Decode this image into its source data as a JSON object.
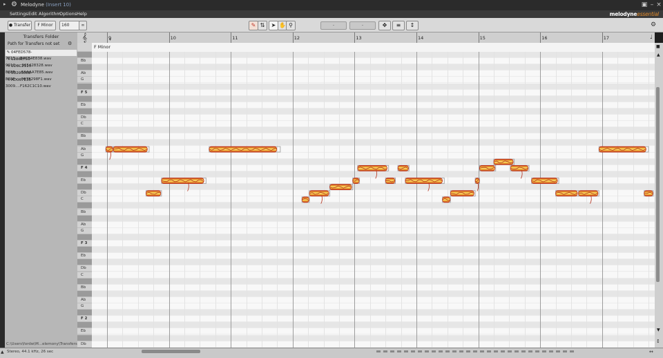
{
  "window": {
    "title": "Melodyne",
    "subtitle": "(Insert 10)"
  },
  "menu": [
    "Settings",
    "Edit",
    "Algorithm",
    "Options",
    "Help"
  ],
  "brand": {
    "name": "melodyne",
    "edition": "essential"
  },
  "toolbar": {
    "transfer_label": "Transfer",
    "key_label": "F Minor",
    "tempo": "160",
    "field_a": "-",
    "field_b": "-"
  },
  "transfers": {
    "header": "Transfers Folder",
    "path_status": "Path for Transfers not set",
    "files": [
      "04FED578-7815....B4CB4E838.wav",
      "1286EF50-991C-....965428328.wav",
      "1D8C2119-E88F-....6AAAA7E85.wav",
      "5B29585B-E88F-....0678298F1.wav",
      "AD067E35-3009....F162C1C10.wav"
    ],
    "footer_path": "C:\\Users\\fordw\\M...elemony\\Transfers"
  },
  "status": {
    "info": "Stereo, 44.1 kHz, 26 sec"
  },
  "ruler": {
    "bars": [
      "9",
      "10",
      "11",
      "12",
      "13",
      "14",
      "15",
      "16",
      "17"
    ]
  },
  "scale": {
    "label": "F Minor"
  },
  "keyboard": {
    "rows": [
      {
        "label": "",
        "t": "b"
      },
      {
        "label": "Bb",
        "t": "w"
      },
      {
        "label": "",
        "t": "b"
      },
      {
        "label": "Ab",
        "t": "w"
      },
      {
        "label": "G",
        "t": "w"
      },
      {
        "label": "",
        "t": "b"
      },
      {
        "label": "F 5",
        "t": "w",
        "f": true
      },
      {
        "label": "",
        "t": "b"
      },
      {
        "label": "Eb",
        "t": "w"
      },
      {
        "label": "",
        "t": "b"
      },
      {
        "label": "Db",
        "t": "w"
      },
      {
        "label": "C",
        "t": "w"
      },
      {
        "label": "",
        "t": "b"
      },
      {
        "label": "Bb",
        "t": "w"
      },
      {
        "label": "",
        "t": "b"
      },
      {
        "label": "Ab",
        "t": "w"
      },
      {
        "label": "G",
        "t": "w"
      },
      {
        "label": "",
        "t": "b"
      },
      {
        "label": "F 4",
        "t": "w",
        "f": true
      },
      {
        "label": "",
        "t": "b"
      },
      {
        "label": "Eb",
        "t": "w"
      },
      {
        "label": "",
        "t": "b"
      },
      {
        "label": "Db",
        "t": "w"
      },
      {
        "label": "C",
        "t": "w"
      },
      {
        "label": "",
        "t": "b"
      },
      {
        "label": "Bb",
        "t": "w"
      },
      {
        "label": "",
        "t": "b"
      },
      {
        "label": "Ab",
        "t": "w"
      },
      {
        "label": "G",
        "t": "w"
      },
      {
        "label": "",
        "t": "b"
      },
      {
        "label": "F 3",
        "t": "w",
        "f": true
      },
      {
        "label": "",
        "t": "b"
      },
      {
        "label": "Eb",
        "t": "w"
      },
      {
        "label": "",
        "t": "b"
      },
      {
        "label": "Db",
        "t": "w"
      },
      {
        "label": "C",
        "t": "w"
      },
      {
        "label": "",
        "t": "b"
      },
      {
        "label": "Bb",
        "t": "w"
      },
      {
        "label": "",
        "t": "b"
      },
      {
        "label": "Ab",
        "t": "w"
      },
      {
        "label": "G",
        "t": "w"
      },
      {
        "label": "",
        "t": "b"
      },
      {
        "label": "F 2",
        "t": "w",
        "f": true
      },
      {
        "label": "",
        "t": "b"
      },
      {
        "label": "Eb",
        "t": "w"
      },
      {
        "label": "",
        "t": "b"
      },
      {
        "label": "Db",
        "t": "w"
      },
      {
        "label": "C",
        "t": "w"
      }
    ]
  },
  "colors": {
    "blob_fill": "#f0b23c",
    "blob_core": "#fbe06a",
    "blob_edge": "#c0321a",
    "pitch_line": "#b5301c",
    "ghost": "#aaaaaa"
  },
  "notes": [
    {
      "start": 8.98,
      "end": 9.1,
      "row": 15
    },
    {
      "start": 9.1,
      "end": 9.68,
      "row": 15
    },
    {
      "start": 9.63,
      "end": 9.88,
      "row": 22
    },
    {
      "start": 9.88,
      "end": 10.6,
      "row": 20
    },
    {
      "start": 10.65,
      "end": 11.8,
      "row": 15
    },
    {
      "start": 12.15,
      "end": 12.27,
      "row": 23
    },
    {
      "start": 12.27,
      "end": 12.6,
      "row": 22
    },
    {
      "start": 12.6,
      "end": 12.97,
      "row": 21
    },
    {
      "start": 12.97,
      "end": 13.08,
      "row": 20
    },
    {
      "start": 13.05,
      "end": 13.55,
      "row": 18
    },
    {
      "start": 13.5,
      "end": 13.66,
      "row": 20
    },
    {
      "start": 13.7,
      "end": 13.88,
      "row": 18
    },
    {
      "start": 13.82,
      "end": 14.45,
      "row": 20
    },
    {
      "start": 14.42,
      "end": 14.55,
      "row": 23
    },
    {
      "start": 14.55,
      "end": 14.95,
      "row": 22
    },
    {
      "start": 14.95,
      "end": 15.02,
      "row": 20
    },
    {
      "start": 15.02,
      "end": 15.28,
      "row": 18
    },
    {
      "start": 15.25,
      "end": 15.58,
      "row": 17
    },
    {
      "start": 15.52,
      "end": 15.82,
      "row": 18
    },
    {
      "start": 15.86,
      "end": 16.3,
      "row": 20
    },
    {
      "start": 16.25,
      "end": 16.62,
      "row": 22
    },
    {
      "start": 16.62,
      "end": 16.95,
      "row": 22
    },
    {
      "start": 16.95,
      "end": 17.75,
      "row": 15
    },
    {
      "start": 17.68,
      "end": 17.85,
      "row": 22
    }
  ]
}
